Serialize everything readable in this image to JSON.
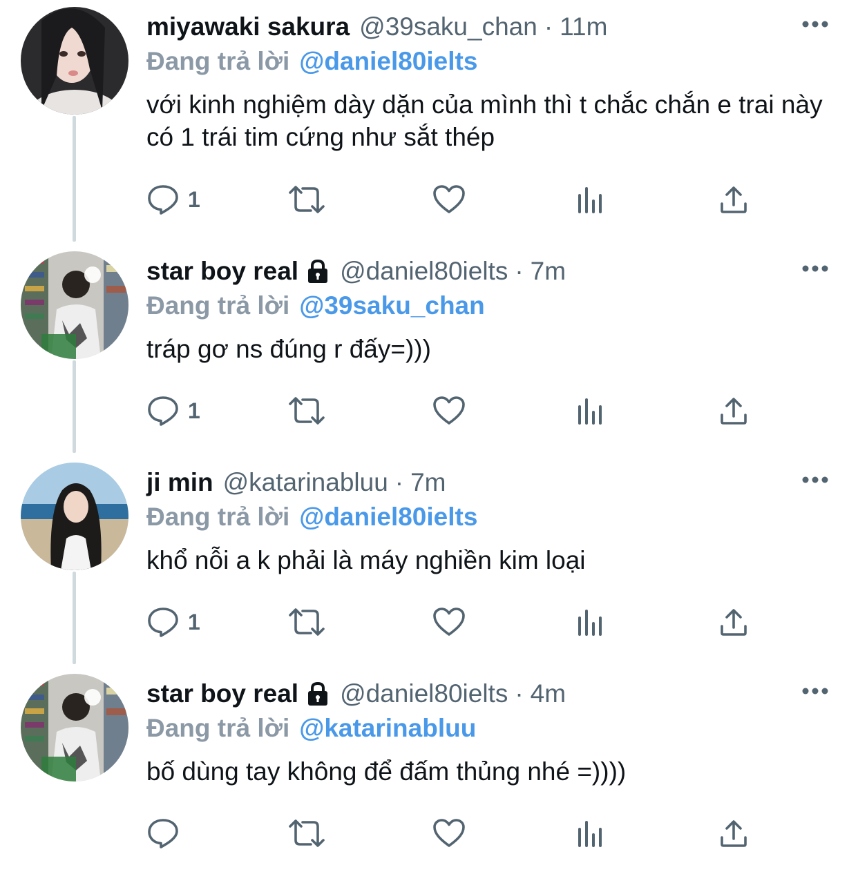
{
  "tweets": [
    {
      "display_name": "miyawaki sakura",
      "verified_lock": false,
      "handle": "@39saku_chan",
      "separator": "·",
      "time": "11m",
      "reply_prefix": "Đang trả lời",
      "reply_to": "@daniel80ielts",
      "text": "với kinh nghiệm dày dặn của mình thì t chắc chắn e trai này có 1 trái tim cứng như sắt thép",
      "reply_count": "1"
    },
    {
      "display_name": "star boy real",
      "verified_lock": true,
      "handle": "@daniel80ielts",
      "separator": "·",
      "time": "7m",
      "reply_prefix": "Đang trả lời",
      "reply_to": "@39saku_chan",
      "text": "tráp gơ ns đúng r đấy=)))",
      "reply_count": "1"
    },
    {
      "display_name": "ji min",
      "verified_lock": false,
      "handle": "@katarinabluu",
      "separator": "·",
      "time": "7m",
      "reply_prefix": "Đang trả lời",
      "reply_to": "@daniel80ielts",
      "text": "khổ nỗi a k phải là máy nghiền kim loại",
      "reply_count": "1"
    },
    {
      "display_name": "star boy real",
      "verified_lock": true,
      "handle": "@daniel80ielts",
      "separator": "·",
      "time": "4m",
      "reply_prefix": "Đang trả lời",
      "reply_to": "@katarinabluu",
      "text": "bố dùng tay không để đấm thủng nhé =))))",
      "reply_count": ""
    }
  ],
  "icons": {
    "reply": "speech-bubble-icon",
    "retweet": "retweet-arrows-icon",
    "like": "heart-icon",
    "views": "bar-chart-icon",
    "share": "upload-arrow-icon",
    "more": "three-dots-icon",
    "lock": "lock-icon"
  },
  "colors": {
    "text": "#0f1419",
    "secondary": "#536471",
    "link": "#4a99e9",
    "thread_line": "#cfd9de"
  }
}
